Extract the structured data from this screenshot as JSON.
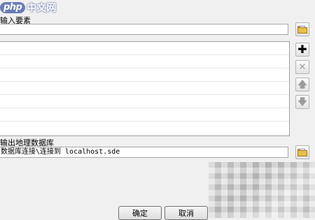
{
  "watermark": {
    "php": "php",
    "cn": "中文网"
  },
  "input_section": {
    "label": "输入要素",
    "value": "",
    "list_rows": 7
  },
  "output_section": {
    "label": "输出地理数据库",
    "value": "数据库连接\\连接到 localhost.sde"
  },
  "side_buttons": {
    "browse_input": "folder-open-icon",
    "add": "plus-icon",
    "remove": "x-icon",
    "move_up": "arrow-up-icon",
    "move_down": "arrow-down-icon",
    "browse_output": "folder-open-icon"
  },
  "dialog_buttons": {
    "ok": "确定",
    "cancel": "取消"
  }
}
